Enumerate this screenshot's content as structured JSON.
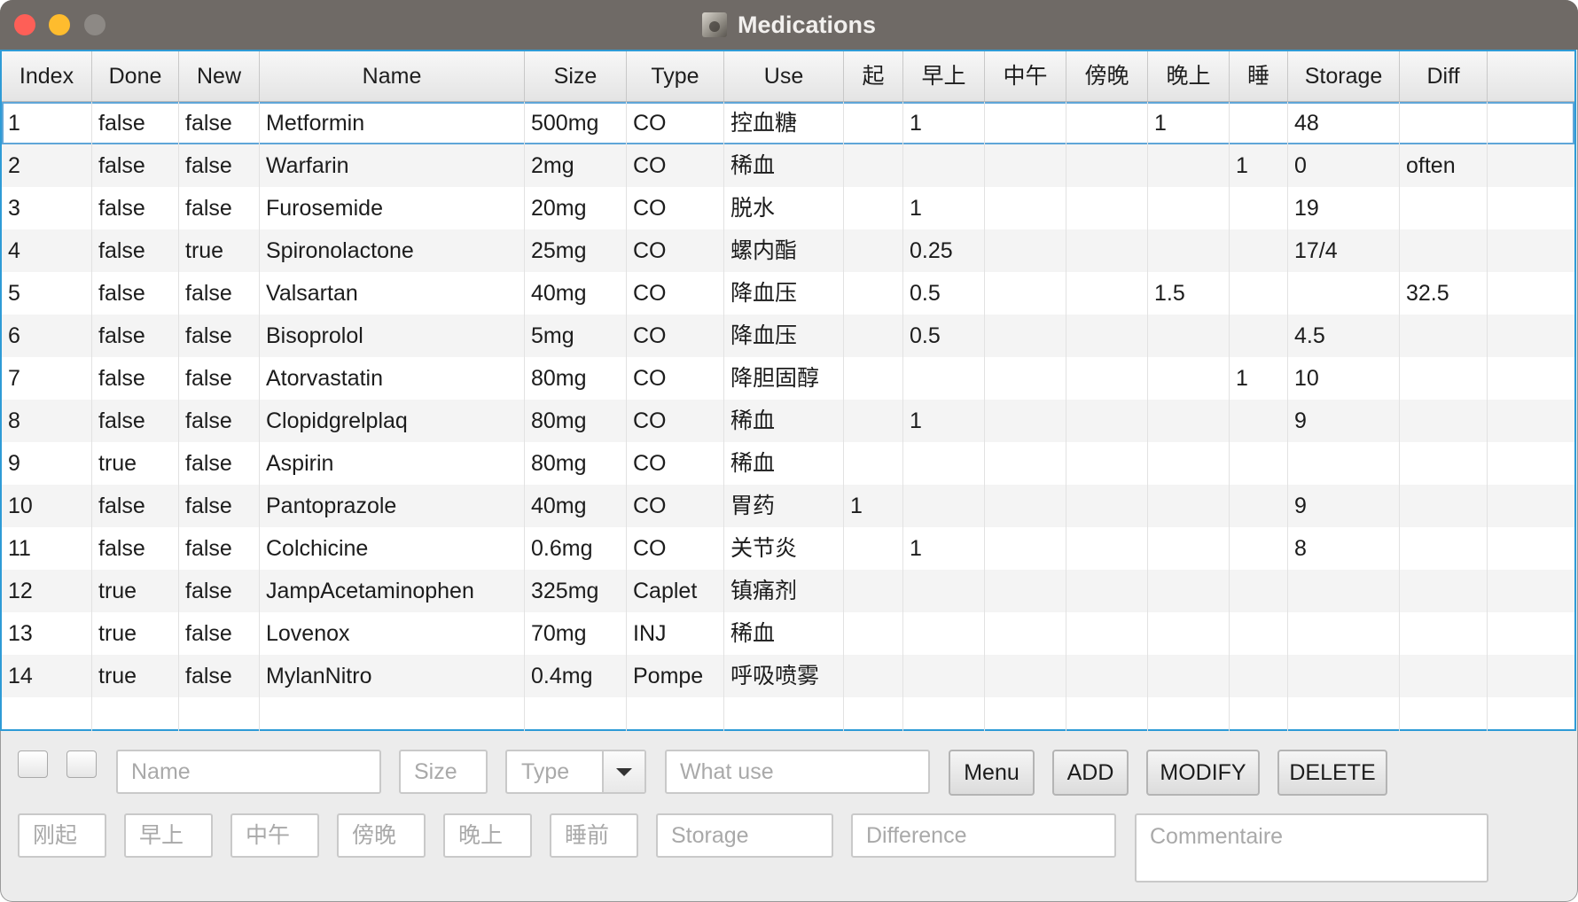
{
  "window": {
    "title": "Medications"
  },
  "table": {
    "columns": [
      "Index",
      "Done",
      "New",
      "Name",
      "Size",
      "Type",
      "Use",
      "起",
      "早上",
      "中午",
      "傍晚",
      "晚上",
      "睡",
      "Storage",
      "Diff"
    ],
    "rows": [
      [
        "1",
        "false",
        "false",
        "Metformin",
        "500mg",
        "CO",
        "控血糖",
        "",
        "1",
        "",
        "",
        "1",
        "",
        "48",
        ""
      ],
      [
        "2",
        "false",
        "false",
        "Warfarin",
        "2mg",
        "CO",
        "稀血",
        "",
        "",
        "",
        "",
        "",
        "1",
        "0",
        "often"
      ],
      [
        "3",
        "false",
        "false",
        "Furosemide",
        "20mg",
        "CO",
        "脱水",
        "",
        "1",
        "",
        "",
        "",
        "",
        "19",
        ""
      ],
      [
        "4",
        "false",
        "true",
        "Spironolactone",
        "25mg",
        "CO",
        "螺内酯",
        "",
        "0.25",
        "",
        "",
        "",
        "",
        "17/4",
        ""
      ],
      [
        "5",
        "false",
        "false",
        "Valsartan",
        "40mg",
        "CO",
        "降血压",
        "",
        "0.5",
        "",
        "",
        "1.5",
        "",
        "",
        "32.5"
      ],
      [
        "6",
        "false",
        "false",
        "Bisoprolol",
        "5mg",
        "CO",
        "降血压",
        "",
        "0.5",
        "",
        "",
        "",
        "",
        "4.5",
        ""
      ],
      [
        "7",
        "false",
        "false",
        "Atorvastatin",
        "80mg",
        "CO",
        "降胆固醇",
        "",
        "",
        "",
        "",
        "",
        "1",
        "10",
        ""
      ],
      [
        "8",
        "false",
        "false",
        "Clopidgrelplaq",
        "80mg",
        "CO",
        "稀血",
        "",
        "1",
        "",
        "",
        "",
        "",
        "9",
        ""
      ],
      [
        "9",
        "true",
        "false",
        "Aspirin",
        "80mg",
        "CO",
        "稀血",
        "",
        "",
        "",
        "",
        "",
        "",
        "",
        ""
      ],
      [
        "10",
        "false",
        "false",
        "Pantoprazole",
        "40mg",
        "CO",
        "胃药",
        "1",
        "",
        "",
        "",
        "",
        "",
        "9",
        ""
      ],
      [
        "11",
        "false",
        "false",
        "Colchicine",
        "0.6mg",
        "CO",
        "关节炎",
        "",
        "1",
        "",
        "",
        "",
        "",
        "8",
        ""
      ],
      [
        "12",
        "true",
        "false",
        "JampAcetaminophen",
        "325mg",
        "Caplet",
        "镇痛剂",
        "",
        "",
        "",
        "",
        "",
        "",
        "",
        ""
      ],
      [
        "13",
        "true",
        "false",
        "Lovenox",
        "70mg",
        "INJ",
        "稀血",
        "",
        "",
        "",
        "",
        "",
        "",
        "",
        ""
      ],
      [
        "14",
        "true",
        "false",
        "MylanNitro",
        "0.4mg",
        "Pompe",
        "呼吸喷雾",
        "",
        "",
        "",
        "",
        "",
        "",
        "",
        ""
      ]
    ]
  },
  "form": {
    "name_placeholder": "Name",
    "size_placeholder": "Size",
    "type_placeholder": "Type",
    "use_placeholder": "What use",
    "menu_label": "Menu",
    "add_label": "ADD",
    "modify_label": "MODIFY",
    "delete_label": "DELETE",
    "wake_placeholder": "刚起",
    "morning_placeholder": "早上",
    "noon_placeholder": "中午",
    "evening_placeholder": "傍晚",
    "night_placeholder": "晚上",
    "bedtime_placeholder": "睡前",
    "storage_placeholder": "Storage",
    "difference_placeholder": "Difference",
    "comment_placeholder": "Commentaire"
  }
}
